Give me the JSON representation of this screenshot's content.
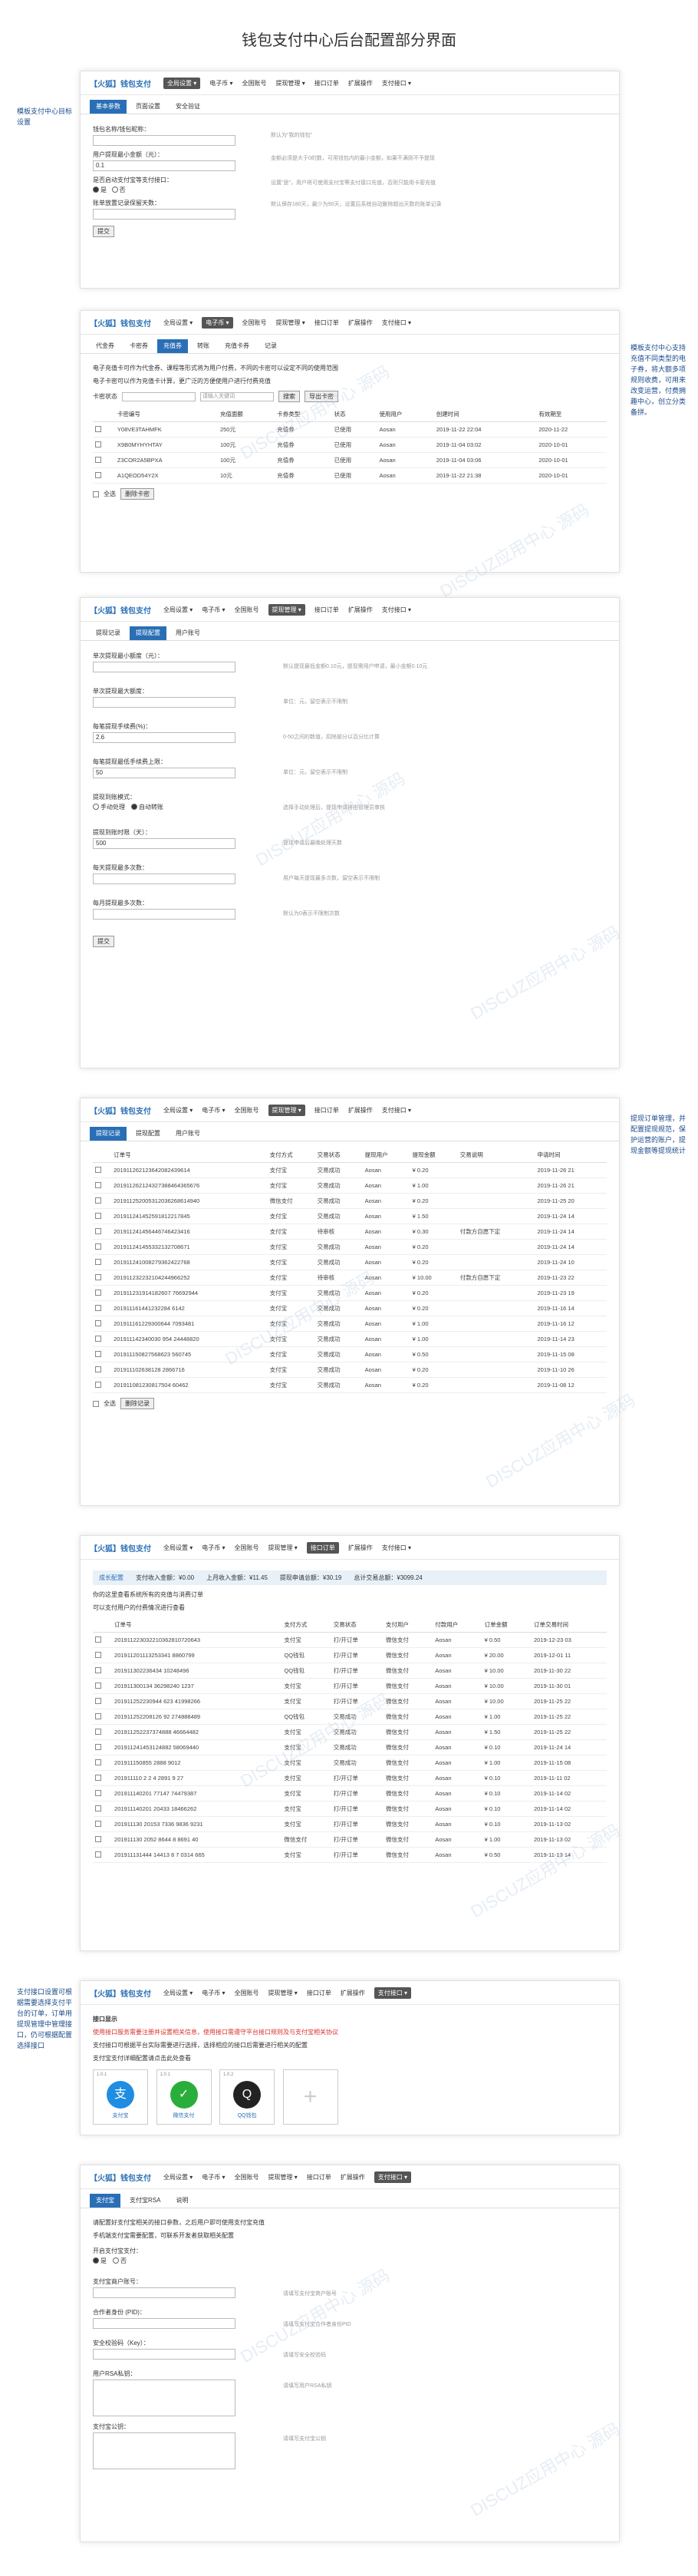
{
  "page_title": "钱包支付中心后台配置部分界面",
  "nav": {
    "logo": "【火狐】钱包支付",
    "items": [
      "全局设置 ▾",
      "电子币 ▾",
      "全国账号",
      "提现管理 ▾",
      "接口订单",
      "扩展操作",
      "支付接口 ▾"
    ]
  },
  "notes": {
    "n1": "模板支付中心目标设置",
    "n2": "模板支付中心支持充值不同类型的电子券，将大额多项规则收费，可用来改变运营，付费拥趣中心，创立分类备拼。",
    "n3": "提现订单管理，并配置提现规范，保护运营的账户，提现金额等提现统计",
    "n4": "支付接口设置可根据需要选择支付平台的订单，订单用提现管理中管理接口，仍可根据配置选择接口"
  },
  "panel1": {
    "tabs": [
      "基本参数",
      "页面设置",
      "安全验证"
    ],
    "f1_label": "钱包名称/钱包昵称：",
    "f1_value": "",
    "f1_hint": "默认为\"我的钱包\"",
    "f2_label": "用户提现最小金额（元）：",
    "f2_value": "0.1",
    "f2_hint": "金额必须是大于0的数，可用钱包内的最小金额，如果不满则不予提现",
    "f3_label": "是否启动支付宝等支付接口：",
    "f3_yes": "是",
    "f3_no": "否",
    "f3_hint": "设置\"是\"，用户将可使用支付宝等支付接口充值，否则只能用卡密充值",
    "f4_label": "账单放置记录保留天数：",
    "f4_value": "",
    "f4_hint": "默认保存180天，最少为90天，设置后系统自动删除超出天数的账单记录",
    "submit": "提交"
  },
  "panel2": {
    "tabs": [
      "代金券",
      "卡密券",
      "充值券",
      "转账",
      "充值卡券",
      "记录"
    ],
    "notice1": "电子充值卡可作为代金券、课程等形式将为用户付费，不同的卡密可以设定不同的使用范围",
    "notice2": "电子卡密可以作为充值卡计算，更广泛的方便使用户进行付费充值",
    "filter_label": "卡密状态",
    "search_placeholder": "请输入关键词",
    "search_btn": "搜索",
    "export_btn": "导出卡密",
    "columns": [
      "卡密编号",
      "充值面额",
      "卡券类型",
      "状态",
      "使用时间",
      "使用用户",
      "创建时间",
      "有效期至"
    ],
    "rows": [
      [
        "Y08VE3TAHMFK",
        "250元",
        "充值券",
        "已使用",
        "Aosan",
        "2019-11-22 22:04",
        "2020-11-22"
      ],
      [
        "X9B0MYHYHTAY",
        "100元",
        "充值券",
        "已使用",
        "Aosan",
        "2019-11-04 03:02",
        "2020-10-01"
      ],
      [
        "Z3COR2A5BPXA",
        "100元",
        "充值券",
        "已使用",
        "Aosan",
        "2019-11-04 03:06",
        "2020-10-01"
      ],
      [
        "A1QEOD54Y2X",
        "10元",
        "充值券",
        "已使用",
        "Aosan",
        "2019-11-22 21:38",
        "2020-10-01"
      ]
    ],
    "footer_all": "全选",
    "footer_del": "删除卡密"
  },
  "panel3": {
    "tabs": [
      "提现记录",
      "提现配置",
      "用户账号"
    ],
    "fields": [
      {
        "label": "单次提现最小额度（元）：",
        "value": "",
        "hint": "默认提现最低金额0.10元，提现需用户申请，最小金额0.10元"
      },
      {
        "label": "单次提现最大额度：",
        "value": "",
        "hint": "单位：元，留空表示不限制"
      },
      {
        "label": "每笔提现手续费(%)：",
        "value": "2.6",
        "hint": "0-50之间的数值，扣除部分以百分比计算"
      },
      {
        "label": "每笔提现最低手续费上限：",
        "value": "50",
        "hint": "单位：元，留空表示不限制"
      },
      {
        "label": "提现到账模式：",
        "value": "",
        "hint": "选择手动处理后，提现申请将由管理员审核"
      },
      {
        "label": "提现到账时限（天）：",
        "value": "500",
        "hint": "提现申请后最晚处理天数"
      },
      {
        "label": "每天提现最多次数：",
        "value": "",
        "hint": "用户每天提现最多次数，留空表示不限制"
      },
      {
        "label": "每月提现最多次数：",
        "value": "",
        "hint": "默认为0表示不限制次数"
      }
    ],
    "mode_manual": "手动处理",
    "mode_auto": "自动转账",
    "submit": "提交"
  },
  "panel4": {
    "tabs": [
      "提现记录",
      "提现配置",
      "用户账号"
    ],
    "columns": [
      "订单号",
      "支付方式",
      "交易状态",
      "提现用户",
      "提现金额",
      "交易说明",
      "申请时间"
    ],
    "rows": [
      [
        "201911262123642082439614",
        "支付宝",
        "交易成功",
        "Aosan",
        "¥ 0.20",
        "",
        "2019-11-26 21"
      ],
      [
        "201911262124327388464365676",
        "支付宝",
        "交易成功",
        "Aosan",
        "¥ 1.00",
        "",
        "2019-11-26 21"
      ],
      [
        "201911252005312036268614940",
        "微信支付",
        "交易成功",
        "Aosan",
        "¥ 0.20",
        "",
        "2019-11-25 20"
      ],
      [
        "201911241452591812217845",
        "支付宝",
        "交易成功",
        "Aosan",
        "¥ 1.50",
        "",
        "2019-11-24 14"
      ],
      [
        "201911241456446746423416",
        "支付宝",
        "待审核",
        "Aosan",
        "¥ 0.30",
        "付款方自愿下定",
        "2019-11-24 14"
      ],
      [
        "201911241455332132708671",
        "支付宝",
        "交易成功",
        "Aosan",
        "¥ 0.20",
        "",
        "2019-11-24 14"
      ],
      [
        "201911241008279362422768",
        "支付宝",
        "交易成功",
        "Aosan",
        "¥ 0.20",
        "",
        "2019-11-24 10"
      ],
      [
        "201911232232104244966252",
        "支付宝",
        "待审核",
        "Aosan",
        "¥ 10.00",
        "付款方自愿下定",
        "2019-11-23 22"
      ],
      [
        "201911231914182607 76692944",
        "支付宝",
        "交易成功",
        "Aosan",
        "¥ 0.20",
        "",
        "2019-11-23 19"
      ],
      [
        "201911161441232284 6142",
        "支付宝",
        "交易成功",
        "Aosan",
        "¥ 0.20",
        "",
        "2019-11-16 14"
      ],
      [
        "201911161229300644 7093481",
        "支付宝",
        "交易成功",
        "Aosan",
        "¥ 1.00",
        "",
        "2019-11-16 12"
      ],
      [
        "201911142340030 954 24448820",
        "支付宝",
        "交易成功",
        "Aosan",
        "¥ 1.00",
        "",
        "2019-11-14 23"
      ],
      [
        "201911150827568623 560745",
        "支付宝",
        "交易成功",
        "Aosan",
        "¥ 0.50",
        "",
        "2019-11-15 08"
      ],
      [
        "201911102638128 2866716",
        "支付宝",
        "交易成功",
        "Aosan",
        "¥ 0.20",
        "",
        "2019-11-10 26"
      ],
      [
        "201911081230817504 60462",
        "支付宝",
        "交易成功",
        "Aosan",
        "¥ 0.20",
        "",
        "2019-11-08 12"
      ]
    ],
    "footer_all": "全选",
    "footer_del": "删除记录"
  },
  "panel5": {
    "bar": [
      "成长配置",
      "支付收入金额：¥0.00",
      "上月收入金额：¥11.45",
      "提现申请总额：¥30.19",
      "总计交易总额：¥3099.24"
    ],
    "notice1": "你的这里查看系统所有的充值与消费订单",
    "notice2": "可以支付用户的付费情况进行查看",
    "columns": [
      "订单号",
      "支付方式",
      "交易状态",
      "支付用户",
      "付款用户",
      "订单金额",
      "订单交易时间"
    ],
    "rows": [
      [
        "201911223032210362810720643",
        "支付宝",
        "打/开订单",
        "微信支付",
        "Aosan",
        "¥ 0.50",
        "2019-12-23 03"
      ],
      [
        "201911201113253341 8860799",
        "QQ钱包",
        "打/开订单",
        "微信支付",
        "Aosan",
        "¥ 20.00",
        "2019-12-01 11"
      ],
      [
        "201911302236434 10248496",
        "QQ钱包",
        "打/开订单",
        "微信支付",
        "Aosan",
        "¥ 10.00",
        "2019-11-30 22"
      ],
      [
        "201911300134 36298240 1237",
        "支付宝",
        "打/开订单",
        "微信支付",
        "Aosan",
        "¥ 10.00",
        "2019-11-30 01"
      ],
      [
        "201911252230944 623 41998266",
        "支付宝",
        "打/开订单",
        "微信支付",
        "Aosan",
        "¥ 10.00",
        "2019-11-25 22"
      ],
      [
        "201911252208126 92 274888489",
        "QQ钱包",
        "交易成功",
        "微信支付",
        "Aosan",
        "¥ 1.00",
        "2019-11-25 22"
      ],
      [
        "201911252237374888 46664482",
        "支付宝",
        "交易成功",
        "微信支付",
        "Aosan",
        "¥ 1.50",
        "2019-11-25 22"
      ],
      [
        "201911241453124882 58069440",
        "支付宝",
        "交易成功",
        "微信支付",
        "Aosan",
        "¥ 0.10",
        "2019-11-24 14"
      ],
      [
        "201911150855 2888 9012",
        "支付宝",
        "交易成功",
        "微信支付",
        "Aosan",
        "¥ 1.00",
        "2019-11-15 08"
      ],
      [
        "201911110 2 2 4 2891 9 27",
        "支付宝",
        "打/开订单",
        "微信支付",
        "Aosan",
        "¥ 0.10",
        "2019-11-11 02"
      ],
      [
        "201911140201 77147 74479387",
        "支付宝",
        "打/开订单",
        "微信支付",
        "Aosan",
        "¥ 0.10",
        "2019-11-14 02"
      ],
      [
        "201911140201 20433 18466262",
        "支付宝",
        "打/开订单",
        "微信支付",
        "Aosan",
        "¥ 0.10",
        "2019-11-14 02"
      ],
      [
        "201911130 20153 7336 9836 9231",
        "支付宝",
        "打/开订单",
        "微信支付",
        "Aosan",
        "¥ 0.10",
        "2019-11-13 02"
      ],
      [
        "201911130 2052 8644 8 8691 40",
        "微信支付",
        "打/开订单",
        "微信支付",
        "Aosan",
        "¥ 1.00",
        "2019-11-13 02"
      ],
      [
        "201911131444 14413 8 7 0314 665",
        "支付宝",
        "打/开订单",
        "微信支付",
        "Aosan",
        "¥ 0.50",
        "2019-11-13 14"
      ]
    ]
  },
  "panel6": {
    "section": "接口显示",
    "warn": "使用接口服务需要注册并设置相关信息，使用接口需遵守平台接口规则及与支付宝相关协议",
    "notice2": "支付接口可根据平台实际需要进行选择，选择相应的接口后需要进行相关的配置",
    "notice3": "支付宝支付详细配置请点击此处查看",
    "icons": [
      {
        "tag": "1.0.1",
        "name": "支付宝",
        "glyph": "支"
      },
      {
        "tag": "1.0.1",
        "name": "微信支付",
        "glyph": "✓"
      },
      {
        "tag": "1.0.2",
        "name": "QQ钱包",
        "glyph": "Q"
      }
    ]
  },
  "panel7": {
    "tabs": [
      "支付宝",
      "支付宝RSA",
      "说明"
    ],
    "notice1": "请配置好支付宝相关的接口参数，之后用户即可使用支付宝充值",
    "notice2": "手机端支付宝需要配置，可联系开发者获取相关配置",
    "fields": [
      {
        "label": "开启支付宝支付：",
        "value": "",
        "hint": ""
      },
      {
        "label": "支付宝商户账号：",
        "value": "",
        "hint": "请填写支付宝商户账号"
      },
      {
        "label": "合作者身份 (PID)：",
        "value": "",
        "hint": "请填写支付宝合作者身份PID"
      },
      {
        "label": "安全校验码（Key）：",
        "value": "",
        "hint": "请填写安全校验码"
      },
      {
        "label": "用户RSA私钥：",
        "value": "",
        "hint": "请填写用户RSA私钥"
      },
      {
        "label": "支付宝公钥：",
        "value": "",
        "hint": "请填写支付宝公钥"
      }
    ],
    "yes": "是",
    "no": "否"
  },
  "watermark": "DISCUZ应用中心 源码"
}
